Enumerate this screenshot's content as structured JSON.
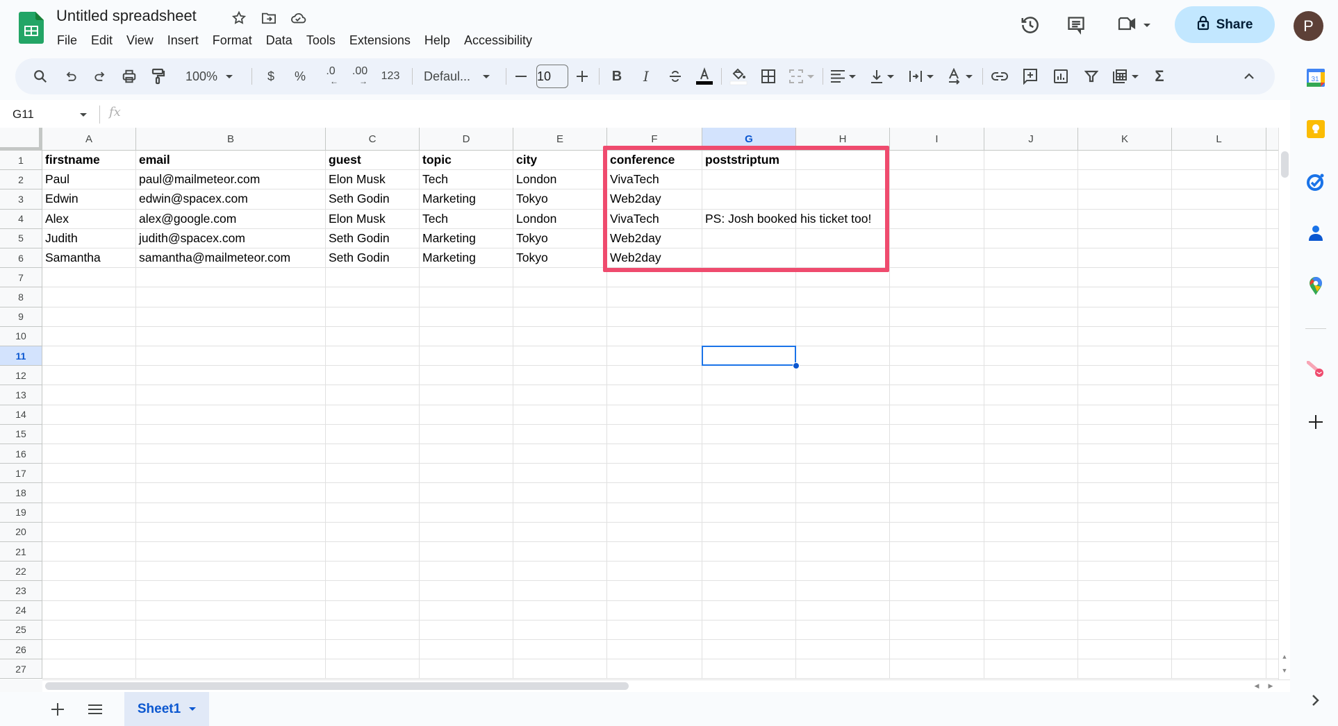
{
  "app": {
    "title": "Untitled spreadsheet",
    "menu": [
      "File",
      "Edit",
      "View",
      "Insert",
      "Format",
      "Data",
      "Tools",
      "Extensions",
      "Help",
      "Accessibility"
    ],
    "share_label": "Share",
    "avatar_initial": "P"
  },
  "toolbar": {
    "zoom": "100%",
    "currency": "$",
    "percent": "%",
    "decrease_decimal": ".0",
    "increase_decimal": ".00",
    "number_format": "123",
    "font": "Defaul...",
    "font_size": "10",
    "bold": "B",
    "italic": "I",
    "sum": "Σ"
  },
  "formula_bar": {
    "name_box": "G11",
    "fx": "fx",
    "formula": ""
  },
  "grid": {
    "columns": [
      "A",
      "B",
      "C",
      "D",
      "E",
      "F",
      "G",
      "H",
      "I",
      "J",
      "K",
      "L"
    ],
    "selected_column": "G",
    "selected_row": 11,
    "selected_cell": "G11",
    "row_numbers": [
      1,
      2,
      3,
      4,
      5,
      6,
      7,
      8,
      9,
      10,
      11,
      12,
      13,
      14,
      15,
      16,
      17,
      18,
      19,
      20,
      21,
      22,
      23,
      24,
      25,
      26,
      27
    ],
    "header_row": [
      "firstname",
      "email",
      "guest",
      "topic",
      "city",
      "conference",
      "poststriptum"
    ],
    "rows": [
      [
        "Paul",
        "paul@mailmeteor.com",
        "Elon Musk",
        "Tech",
        "London",
        "VivaTech",
        ""
      ],
      [
        "Edwin",
        "edwin@spacex.com",
        "Seth Godin",
        "Marketing",
        "Tokyo",
        "Web2day",
        ""
      ],
      [
        "Alex",
        "alex@google.com",
        "Elon Musk",
        "Tech",
        "London",
        "VivaTech",
        "PS: Josh booked his ticket too!"
      ],
      [
        "Judith",
        "judith@spacex.com",
        "Seth Godin",
        "Marketing",
        "Tokyo",
        "Web2day",
        ""
      ],
      [
        "Samantha",
        "samantha@mailmeteor.com",
        "Seth Godin",
        "Marketing",
        "Tokyo",
        "Web2day",
        ""
      ]
    ],
    "highlight_range": "F1:H6",
    "highlight_color": "#EF4B6E"
  },
  "sheets": {
    "tabs": [
      {
        "label": "Sheet1",
        "active": true
      }
    ]
  },
  "side_panel": {
    "apps": [
      "calendar-icon",
      "keep-icon",
      "tasks-icon",
      "contacts-icon",
      "maps-icon",
      "mailmeteor-icon"
    ],
    "calendar_day": "31"
  },
  "colors": {
    "accent": "#0b57d0",
    "share_bg": "#C2E7FF",
    "avatar_bg": "#5D4037",
    "toolbar_bg": "#EDF2FA",
    "selection_header_bg": "#D3E3FD"
  }
}
